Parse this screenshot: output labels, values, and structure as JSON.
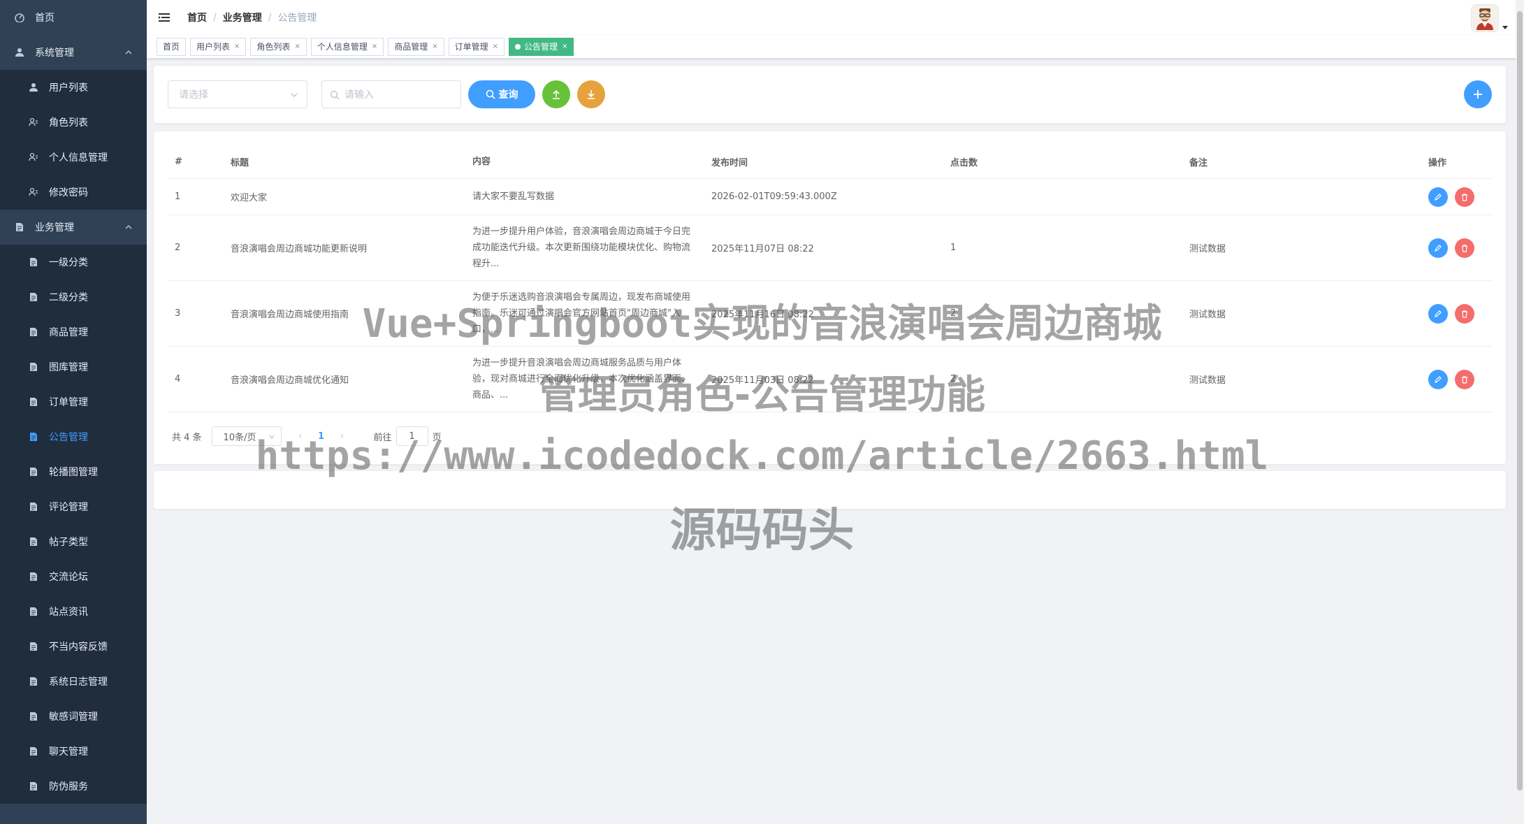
{
  "sidebar": {
    "items": [
      {
        "label": "首页",
        "icon": "dashboard-icon",
        "level": "top"
      },
      {
        "label": "系统管理",
        "icon": "user-icon",
        "level": "group",
        "expanded": true
      },
      {
        "label": "用户列表",
        "icon": "user-icon",
        "level": "sub"
      },
      {
        "label": "角色列表",
        "icon": "peoples-icon",
        "level": "sub"
      },
      {
        "label": "个人信息管理",
        "icon": "peoples-icon",
        "level": "sub"
      },
      {
        "label": "修改密码",
        "icon": "peoples-icon",
        "level": "sub"
      },
      {
        "label": "业务管理",
        "icon": "document-icon",
        "level": "group",
        "expanded": true
      },
      {
        "label": "一级分类",
        "icon": "document-icon",
        "level": "sub"
      },
      {
        "label": "二级分类",
        "icon": "document-icon",
        "level": "sub"
      },
      {
        "label": "商品管理",
        "icon": "document-icon",
        "level": "sub"
      },
      {
        "label": "图库管理",
        "icon": "document-icon",
        "level": "sub"
      },
      {
        "label": "订单管理",
        "icon": "document-icon",
        "level": "sub"
      },
      {
        "label": "公告管理",
        "icon": "document-icon",
        "level": "sub",
        "active": true
      },
      {
        "label": "轮播图管理",
        "icon": "document-icon",
        "level": "sub"
      },
      {
        "label": "评论管理",
        "icon": "document-icon",
        "level": "sub"
      },
      {
        "label": "帖子类型",
        "icon": "document-icon",
        "level": "sub"
      },
      {
        "label": "交流论坛",
        "icon": "document-icon",
        "level": "sub"
      },
      {
        "label": "站点资讯",
        "icon": "document-icon",
        "level": "sub"
      },
      {
        "label": "不当内容反馈",
        "icon": "document-icon",
        "level": "sub"
      },
      {
        "label": "系统日志管理",
        "icon": "document-icon",
        "level": "sub"
      },
      {
        "label": "敏感词管理",
        "icon": "document-icon",
        "level": "sub"
      },
      {
        "label": "聊天管理",
        "icon": "document-icon",
        "level": "sub"
      },
      {
        "label": "防伪服务",
        "icon": "document-icon",
        "level": "sub"
      }
    ]
  },
  "navbar": {
    "breadcrumb": [
      "首页",
      "业务管理",
      "公告管理"
    ],
    "hamburger_icon": "hamburger-icon",
    "avatar_icon": "avatar-icon"
  },
  "tags": [
    {
      "label": "首页",
      "closable": false
    },
    {
      "label": "用户列表",
      "closable": true
    },
    {
      "label": "角色列表",
      "closable": true
    },
    {
      "label": "个人信息管理",
      "closable": true
    },
    {
      "label": "商品管理",
      "closable": true
    },
    {
      "label": "订单管理",
      "closable": true
    },
    {
      "label": "公告管理",
      "closable": true,
      "active": true
    }
  ],
  "search": {
    "select_placeholder": "请选择",
    "input_placeholder": "请输入",
    "query_label": "查询"
  },
  "table": {
    "headers": [
      "#",
      "标题",
      "内容",
      "发布时间",
      "点击数",
      "备注",
      "操作"
    ],
    "rows": [
      {
        "idx": "1",
        "title": "欢迎大家",
        "content": "请大家不要乱写数据",
        "time": "2026-02-01T09:59:43.000Z",
        "clicks": "",
        "note": ""
      },
      {
        "idx": "2",
        "title": "音浪演唱会周边商城功能更新说明",
        "content": "为进一步提升用户体验，音浪演唱会周边商城于今日完成功能迭代升级。本次更新围绕功能模块优化、购物流程升...",
        "time": "2025年11月07日 08:22",
        "clicks": "1",
        "note": "测试数据"
      },
      {
        "idx": "3",
        "title": "音浪演唱会周边商城使用指南",
        "content": "为便于乐迷选购音浪演唱会专属周边，现发布商城使用指南。乐迷可通过演唱会官方网站首页\"周边商城\"入口，...",
        "time": "2025年11月16日 08:22",
        "clicks": "2",
        "note": "测试数据"
      },
      {
        "idx": "4",
        "title": "音浪演唱会周边商城优化通知",
        "content": "为进一步提升音浪演唱会周边商城服务品质与用户体验，现对商城进行全面优化升级，本次优化涵盖界面、商品、...",
        "time": "2025年11月03日 08:22",
        "clicks": "2",
        "note": "测试数据"
      }
    ]
  },
  "pagination": {
    "total": "共 4 条",
    "page_size": "10条/页",
    "current": "1",
    "goto_prefix": "前往",
    "goto_value": "1",
    "goto_suffix": "页"
  },
  "watermark": {
    "line1": "Vue+Springboot实现的音浪演唱会周边商城",
    "line2": "管理员角色-公告管理功能",
    "line3": "https://www.icodedock.com/article/2663.html",
    "line4": "源码码头"
  },
  "colors": {
    "sidebar_bg": "#304156",
    "accent": "#409eff",
    "success": "#67c23a",
    "warning": "#e6a23c",
    "danger": "#f56c6c",
    "tag_active": "#42b983"
  }
}
